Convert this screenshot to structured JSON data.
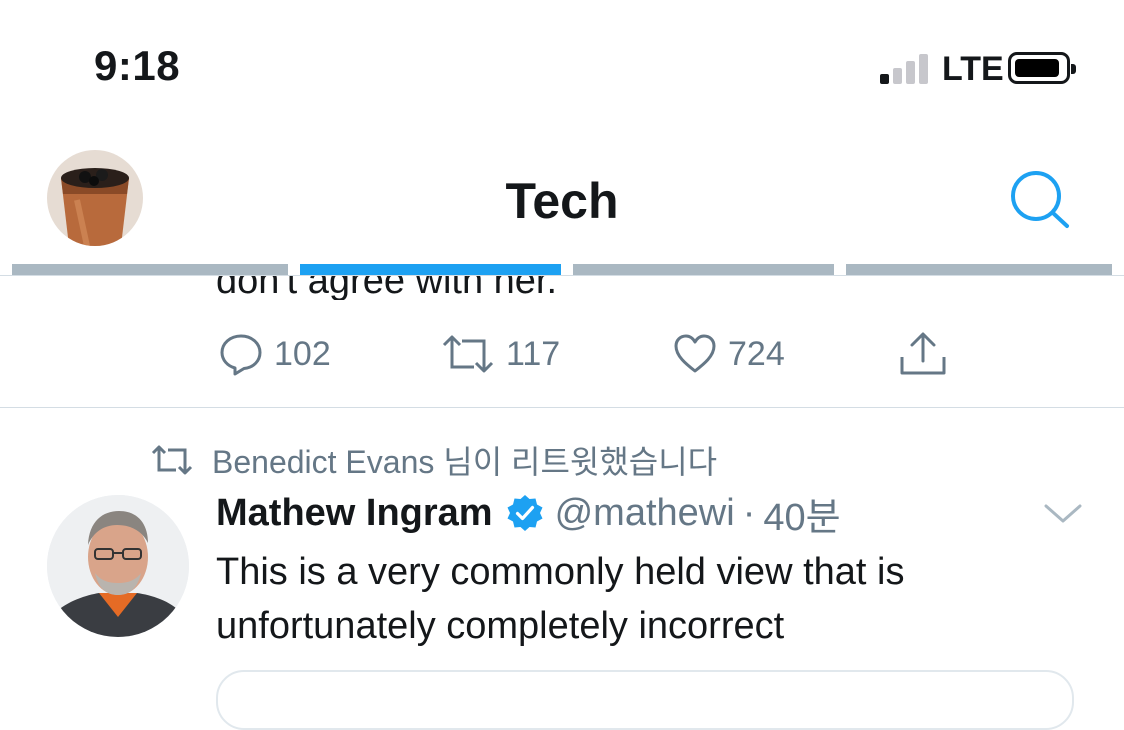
{
  "status_bar": {
    "time": "9:18",
    "network": "LTE"
  },
  "header": {
    "title": "Tech",
    "search_icon": "search-icon"
  },
  "tabs": [
    {
      "active": false
    },
    {
      "active": true
    },
    {
      "active": false
    },
    {
      "active": false
    }
  ],
  "previous_tweet": {
    "clipped_text": "don't agree with her.",
    "actions": {
      "replies": "102",
      "retweets": "117",
      "likes": "724"
    }
  },
  "tweet": {
    "retweet_context": "Benedict Evans 님이 리트윗했습니다",
    "author_name": "Mathew Ingram",
    "handle": "@mathewi",
    "separator": "·",
    "time": "40분",
    "text_lines": [
      "This is a very commonly held view that is",
      "unfortunately completely incorrect"
    ]
  },
  "colors": {
    "accent": "#1da1f2",
    "secondary_text": "#657786",
    "tab_inactive": "#aab8c2"
  }
}
